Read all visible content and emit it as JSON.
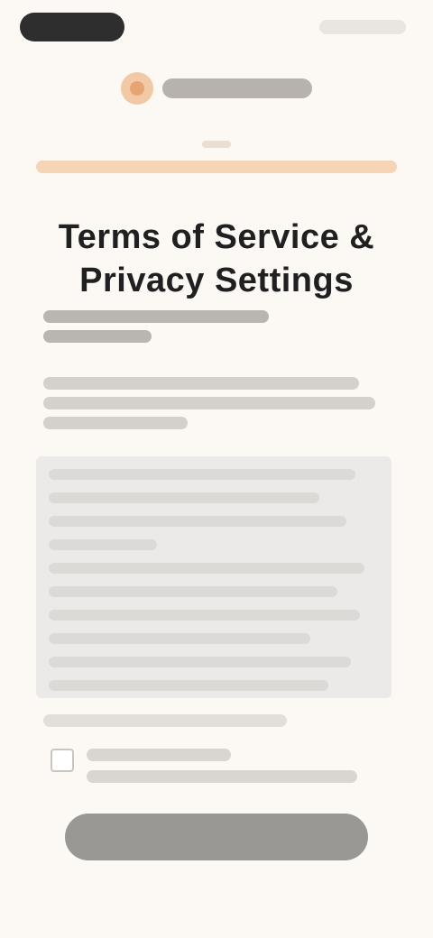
{
  "page": {
    "title": "Terms of Service & Privacy Settings"
  },
  "colors": {
    "background": "#fcf9f5",
    "accent": "#f1c9a4",
    "button": "#9a9894"
  },
  "icons": {
    "logo": "brand-logo-icon",
    "checkbox": "checkbox-icon"
  }
}
